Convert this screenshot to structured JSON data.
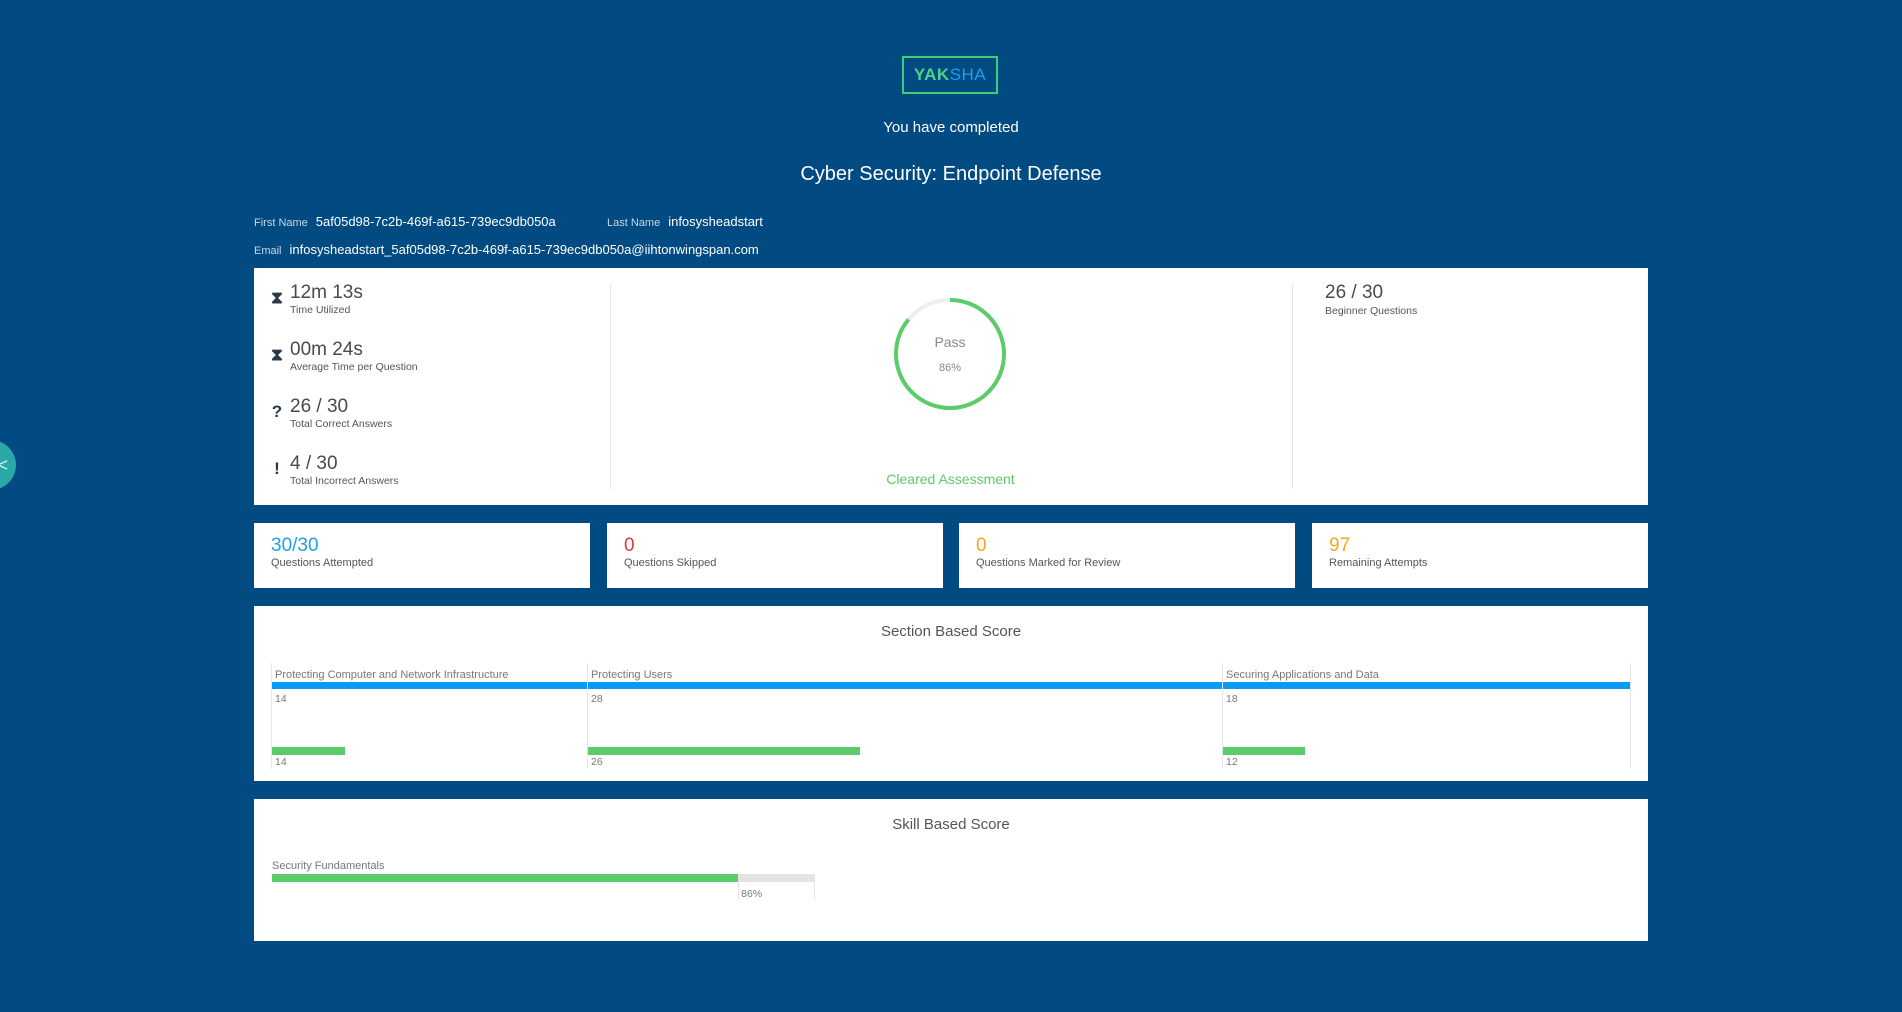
{
  "logo": {
    "part1": "YAK",
    "part2": "SHA"
  },
  "header": {
    "completed_text": "You have completed",
    "course_title": "Cyber Security: Endpoint Defense"
  },
  "candidate": {
    "first_name_label": "First Name",
    "first_name": "5af05d98-7c2b-469f-a615-739ec9db050a",
    "last_name_label": "Last Name",
    "last_name": "infosysheadstart",
    "email_label": "Email",
    "email": "infosysheadstart_5af05d98-7c2b-469f-a615-739ec9db050a@iihtonwingspan.com"
  },
  "summary": {
    "stats": [
      {
        "icon": "hourglass-icon",
        "glyph": "⧗",
        "value": "12m 13s",
        "label": "Time Utilized"
      },
      {
        "icon": "hourglass-icon",
        "glyph": "⧗",
        "value": "00m 24s",
        "label": "Average Time per Question"
      },
      {
        "icon": "question-icon",
        "glyph": "?",
        "value": "26 / 30",
        "label": "Total Correct Answers"
      },
      {
        "icon": "exclamation-icon",
        "glyph": "!",
        "value": "4 / 30",
        "label": "Total Incorrect Answers"
      }
    ],
    "result": {
      "status": "Pass",
      "percent_text": "86%",
      "percent": 86,
      "cleared_text": "Cleared Assessment"
    },
    "beginner": {
      "value": "26 / 30",
      "label": "Beginner Questions"
    }
  },
  "counters": [
    {
      "value": "30/30",
      "label": "Questions Attempted",
      "color": "#1e9fe6"
    },
    {
      "value": "0",
      "label": "Questions Skipped",
      "color": "#e8344b"
    },
    {
      "value": "0",
      "label": "Questions Marked for Review",
      "color": "#f5a623"
    },
    {
      "value": "97",
      "label": "Remaining Attempts",
      "color": "#f5a623"
    }
  ],
  "section_score": {
    "title": "Section Based Score",
    "sections": [
      {
        "name": "Protecting Computer and Network Infrastructure",
        "total": "14",
        "scored": "14"
      },
      {
        "name": "Protecting Users",
        "total": "28",
        "scored": "26"
      },
      {
        "name": "Securing Applications and Data",
        "total": "18",
        "scored": "12"
      }
    ]
  },
  "skill_score": {
    "title": "Skill Based Score",
    "skills": [
      {
        "name": "Security Fundamentals",
        "percent_text": "86%",
        "percent": 86
      }
    ]
  },
  "colors": {
    "background": "#014b82",
    "pass": "#5ccc6a",
    "total_bar": "#0a9cf5"
  }
}
